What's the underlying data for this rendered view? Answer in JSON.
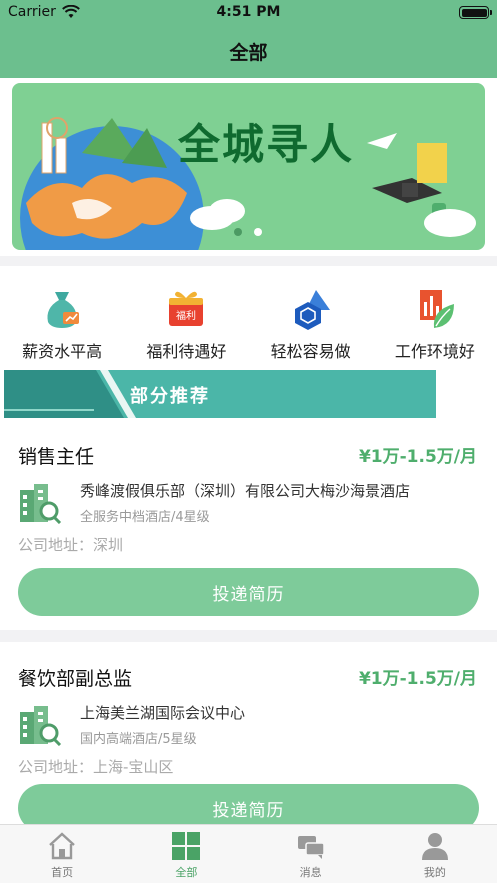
{
  "status_bar": {
    "carrier": "Carrier",
    "time": "4:51 PM"
  },
  "nav": {
    "title": "全部"
  },
  "banner": {
    "title": "全城寻人",
    "slide_count": 2,
    "active_slide": 2
  },
  "categories": [
    {
      "label": "薪资水平高",
      "icon": "money-bag-icon"
    },
    {
      "label": "福利待遇好",
      "icon": "gift-box-icon",
      "badge": "福利"
    },
    {
      "label": "轻松容易做",
      "icon": "cube-icon"
    },
    {
      "label": "工作环境好",
      "icon": "leaf-chart-icon"
    }
  ],
  "section": {
    "title": "部分推荐"
  },
  "jobs": [
    {
      "title": "销售主任",
      "salary": "¥1万-1.5万/月",
      "company": "秀峰渡假俱乐部（深圳）有限公司大梅沙海景酒店",
      "company_type": "全服务中档酒店/4星级",
      "address": "公司地址：深圳",
      "apply_label": "投递简历"
    },
    {
      "title": "餐饮部副总监",
      "salary": "¥1万-1.5万/月",
      "company": "上海美兰湖国际会议中心",
      "company_type": "国内高端酒店/5星级",
      "address": "公司地址：上海-宝山区",
      "apply_label": "投递简历"
    }
  ],
  "tabbar": [
    {
      "label": "首页",
      "icon": "home-icon",
      "active": false
    },
    {
      "label": "全部",
      "icon": "grid-icon",
      "active": true
    },
    {
      "label": "消息",
      "icon": "chat-icon",
      "active": false
    },
    {
      "label": "我的",
      "icon": "person-icon",
      "active": false
    }
  ],
  "colors": {
    "primary": "#6cbf8e",
    "accent_green": "#4fae6d",
    "button": "#7ecb9a",
    "section_bar": "#4bb6a8"
  }
}
